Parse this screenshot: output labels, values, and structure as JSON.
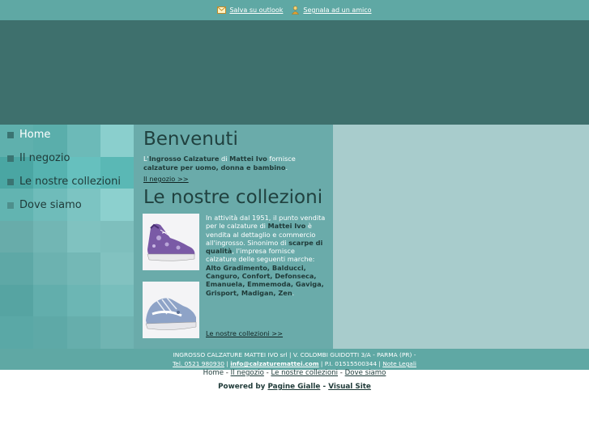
{
  "topbar": {
    "links": [
      {
        "label": "Salva su outlook",
        "icon": "outlook-icon"
      },
      {
        "label": "Segnala ad un amico",
        "icon": "friend-icon"
      }
    ]
  },
  "menu": {
    "items": [
      {
        "label": "Home",
        "active": true
      },
      {
        "label": "Il negozio",
        "active": false
      },
      {
        "label": "Le nostre collezioni",
        "active": false
      },
      {
        "label": "Dove siamo",
        "active": false
      }
    ]
  },
  "content": {
    "welcome_title": "Benvenuti",
    "intro": {
      "p1": "L'",
      "b1": "Ingrosso Calzature",
      "p2": " di ",
      "b2": "Mattei Ivo",
      "p3": " fornisce ",
      "b3": "calzature per uomo, donna e bambino",
      "p4": "."
    },
    "intro_link": "Il negozio >>",
    "collections_title": "Le nostre collezioni",
    "para": {
      "t1": "In attività dal 1951, il punto vendita per le calzature di ",
      "b1": "Mattei Ivo",
      "t2": " è vendita al dettaglio e commercio all'ingrosso. Sinonimo di ",
      "b2": "scarpe di qualità",
      "t3": ", l'impresa fornisce calzature delle seguenti marche: ",
      "b3": "Alto Gradimento, Balducci, Canguro, Confort, Defonseca, Emanuela, Emmemoda, Gaviga, Grisport, Madigan, Zen",
      "t4": "."
    },
    "collections_link": "Le nostre collezioni >>"
  },
  "footer": {
    "line1": "INGROSSO CALZATURE MATTEI IVO srl | V. COLOMBI GUIDOTTI 3/A - PARMA (PR) -",
    "tel": "Tel. 0521 980930",
    "sep1": " | ",
    "email": "info@calzaturemattei.com",
    "piva": " | P.I. 01515500344 | ",
    "legal": "Note Legali"
  },
  "bottom_nav": {
    "items": [
      "Home",
      "Il negozio",
      "Le nostre collezioni",
      "Dove siamo"
    ],
    "sep": " - "
  },
  "powered": {
    "label": "Powered by",
    "link1": "Pagine Gialle",
    "dash": "-",
    "link2": "Visual Site"
  },
  "colors": {
    "topbar": "#5fa8a4",
    "banner": "#3e706d",
    "content_bg": "#6aabaa",
    "right_panel": "#a8cccc",
    "title": "#20413f"
  }
}
